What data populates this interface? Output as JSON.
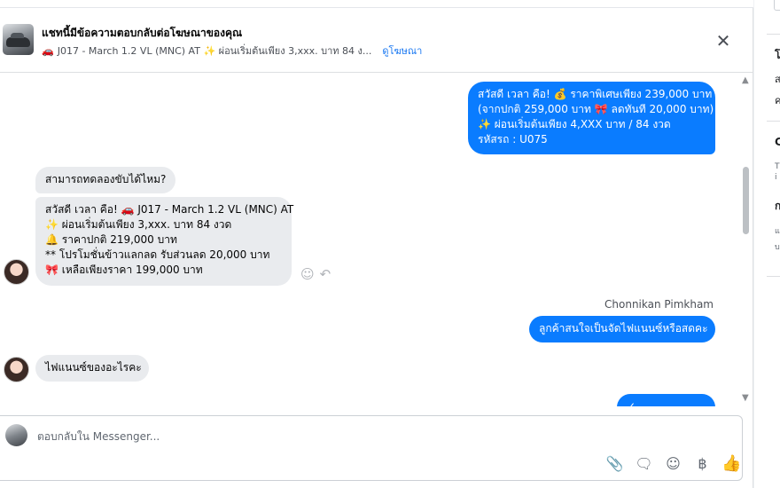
{
  "header": {
    "title": "แชทนี้มีข้อความตอบกลับต่อโฆษณาของคุณ",
    "ad_icon": "🚗",
    "ad_text": "J017 - March 1.2 VL (MNC) AT ✨ ผ่อนเริ่มต้นเพียง 3,xxx. บาท 84 ง...",
    "view_ad_link": "ดูโฆษณา",
    "close_label": "✕"
  },
  "messages": {
    "m1_lines": [
      "สวัสดี เวลา คือ! 💰 ราคาพิเศษเพียง 239,000 บาท",
      "(จากปกติ 259,000 บาท 🎀 ลดทันที 20,000 บาท)",
      "✨ ผ่อนเริ่มต้นเพียง 4,XXX บาท / 84 งวด",
      "รหัสรถ : U075"
    ],
    "m2": "สามารถทดลองขับได้ไหม?",
    "m3_lines": [
      "สวัสดี เวลา คือ! 🚗 J017 - March 1.2 VL (MNC) AT",
      "✨ ผ่อนเริ่มต้นเพียง 3,xxx. บาท 84 งวด",
      "🔔 ราคาปกติ 219,000 บาท",
      "** โปรโมชั่นข้าวแลกลด รับส่วนลด 20,000 บาท",
      "🎀 เหลือเพียงราคา 199,000 บาท"
    ],
    "sender_name": "Chonnikan Pimkham",
    "m4": "ลูกค้าสนใจเป็นจัดไฟแนนซ์หรือสดคะ",
    "m5": "ไฟแนนซ์ของอะไรคะ",
    "m6": "✓"
  },
  "composer": {
    "placeholder": "ตอบกลับใน Messenger...",
    "tools": [
      "attach-icon",
      "chat-icon",
      "emoji-icon",
      "baht-icon",
      "like-icon"
    ],
    "tool_glyphs": [
      "📎",
      "🗨",
      "☺",
      "฿",
      "👍"
    ]
  },
  "side": {
    "lines": [
      "โ",
      "ส",
      "ค",
      "C",
      "T",
      "i",
      "ก",
      "แ",
      "บ"
    ]
  },
  "colors": {
    "outgoing": "#0a7cff",
    "incoming": "#e9ebee",
    "link": "#1877f2"
  }
}
